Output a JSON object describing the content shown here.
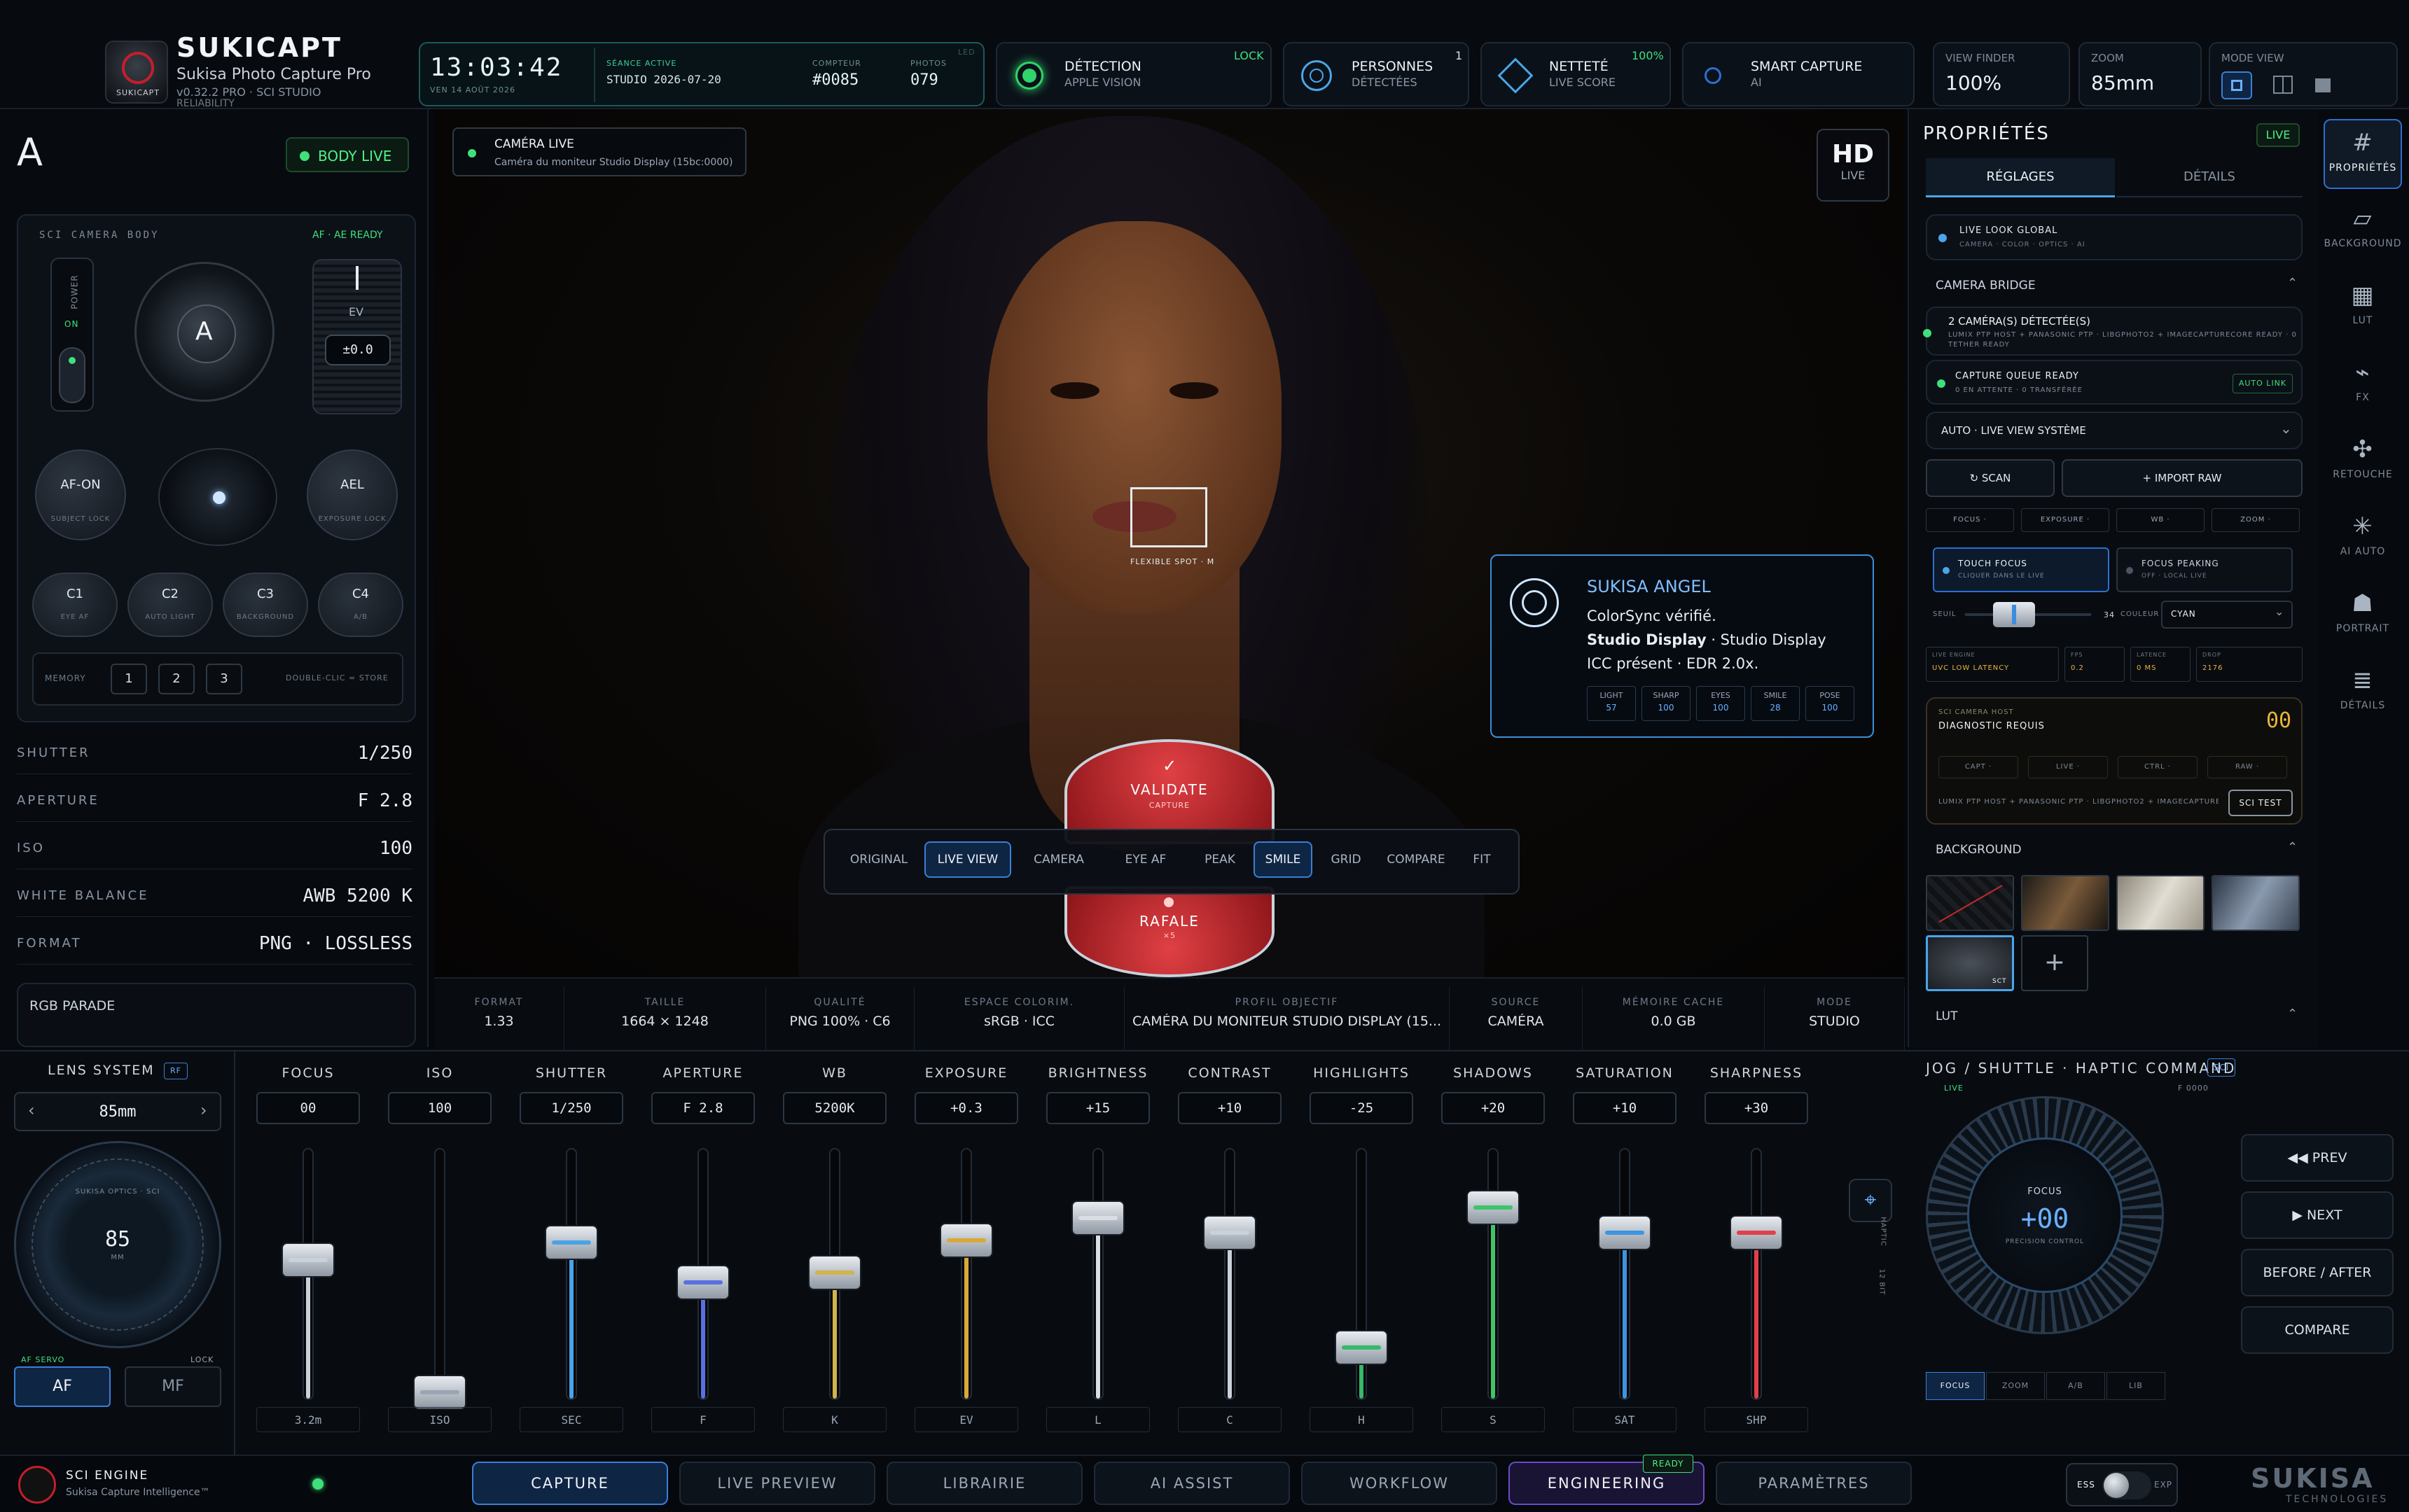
{
  "app": {
    "name": "SUKICAPT",
    "subtitle": "Sukisa Photo Capture Pro",
    "version": "v0.32.2 PRO · SCI STUDIO",
    "tag": "RELIABILITY",
    "logo_text": "SUKICAPT"
  },
  "clock": {
    "time": "13:03:42",
    "date": "VEN 14 AOÛT 2026",
    "session_label": "SÉANCE ACTIVE",
    "session": "STUDIO 2026-07-20",
    "counter_label": "COMPTEUR",
    "counter": "#0085",
    "photos_label": "PHOTOS",
    "photos": "079",
    "led": "LED"
  },
  "status": {
    "detection": {
      "title": "DÉTECTION",
      "sub": "APPLE VISION",
      "badge": "LOCK"
    },
    "persons": {
      "title": "PERSONNES",
      "sub": "DÉTECTÉES",
      "badge": "1"
    },
    "sharp": {
      "title": "NETTETÉ",
      "sub": "LIVE SCORE",
      "badge": "100%"
    },
    "smart": {
      "title": "SMART CAPTURE",
      "sub": "AI"
    },
    "viewfinder": {
      "label": "VIEW FINDER",
      "value": "100%"
    },
    "zoom": {
      "label": "ZOOM",
      "value": "85mm"
    },
    "mode": {
      "label": "MODE VIEW"
    }
  },
  "left": {
    "mode_letter": "A",
    "body_live": "BODY LIVE",
    "body_label": "SCI CAMERA BODY",
    "af_ready": "AF · AE READY",
    "power": "POWER",
    "on": "ON",
    "dial_letter": "A",
    "ev_label": "EV",
    "ev_value": "±0.0",
    "afon": "AF-ON",
    "afon_sub": "SUBJECT LOCK",
    "ael": "AEL",
    "ael_sub": "EXPOSURE LOCK",
    "customs": [
      {
        "t": "C1",
        "s": "EYE AF"
      },
      {
        "t": "C2",
        "s": "AUTO LIGHT"
      },
      {
        "t": "C3",
        "s": "BACKGROUND"
      },
      {
        "t": "C4",
        "s": "A/B"
      }
    ],
    "memory": "MEMORY",
    "mem": [
      "1",
      "2",
      "3"
    ],
    "mem_hint": "DOUBLE-CLIC = STORE",
    "props": [
      {
        "k": "SHUTTER",
        "v": "1/250"
      },
      {
        "k": "APERTURE",
        "v": "F 2.8"
      },
      {
        "k": "ISO",
        "v": "100"
      },
      {
        "k": "WHITE BALANCE",
        "v": "AWB  5200 K"
      },
      {
        "k": "FORMAT",
        "v": "PNG · LOSSLESS"
      }
    ],
    "rgb": "RGB PARADE"
  },
  "viewer": {
    "cam_title": "CAMÉRA LIVE",
    "cam_sub": "Caméra du moniteur Studio Display (15bc:0000)",
    "hd": "HD",
    "hd_sub": "LIVE",
    "spot": "FLEXIBLE SPOT · M",
    "angel_title": "SUKISA ANGEL",
    "angel_l1": "ColorSync vérifié.",
    "angel_l2b": "Studio Display",
    "angel_l2": " · Studio Display",
    "angel_l3": "ICC présent · EDR 2.0x.",
    "scores": [
      {
        "k": "LIGHT",
        "v": "57"
      },
      {
        "k": "SHARP",
        "v": "100"
      },
      {
        "k": "EYES",
        "v": "100"
      },
      {
        "k": "SMILE",
        "v": "28"
      },
      {
        "k": "POSE",
        "v": "100"
      }
    ],
    "validate": "VALIDATE",
    "validate_sub": "CAPTURE",
    "rafale": "RAFALE",
    "rafale_sub": "×5",
    "view_btns": [
      "ORIGINAL",
      "LIVE VIEW",
      "CAMERA",
      "EYE AF",
      "PEAK",
      "SMILE",
      "GRID",
      "COMPARE",
      "FIT"
    ],
    "info": [
      {
        "k": "FORMAT",
        "v": "1.33"
      },
      {
        "k": "TAILLE",
        "v": "1664 × 1248"
      },
      {
        "k": "QUALITÉ",
        "v": "PNG 100% · C6"
      },
      {
        "k": "ESPACE COLORIM.",
        "v": "sRGB · ICC"
      },
      {
        "k": "PROFIL OBJECTIF",
        "v": "CAMÉRA DU MONITEUR STUDIO DISPLAY (15..."
      },
      {
        "k": "SOURCE",
        "v": "CAMÉRA"
      },
      {
        "k": "MÉMOIRE CACHE",
        "v": "0.0 GB"
      },
      {
        "k": "MODE",
        "v": "STUDIO"
      }
    ]
  },
  "props": {
    "title": "PROPRIÉTÉS",
    "live": "LIVE",
    "tab1": "RÉGLAGES",
    "tab2": "DÉTAILS",
    "look": "LIVE LOOK GLOBAL",
    "look_sub": "CAMERA · COLOR · OPTICS · AI",
    "bridge": "CAMERA BRIDGE",
    "cams": "2 CAMÉRA(S) DÉTECTÉE(S)",
    "cams_sub": "LUMIX PTP HOST + PANASONIC PTP · LIBGPHOTO2 + IMAGECAPTURECORE READY · 0 TETHER READY",
    "queue": "CAPTURE QUEUE READY",
    "queue_sub": "0 EN ATTENTE · 0 TRANSFÉRÉE",
    "auto_link": "AUTO LINK",
    "select": "AUTO · LIVE VIEW SYSTÈME",
    "scan": "↻ SCAN",
    "import": "+ IMPORT RAW",
    "mini": [
      "FOCUS ·",
      "EXPOSURE ·",
      "WB ·",
      "ZOOM ·"
    ],
    "touch": "TOUCH FOCUS",
    "touch_sub": "CLIQUER DANS LE LIVE",
    "peaking": "FOCUS PEAKING",
    "peaking_sub": "OFF · LOCAL LIVE",
    "seuil": "SEUIL",
    "seuil_v": "34",
    "couleur": "COULEUR",
    "couleur_v": "CYAN",
    "engine": [
      {
        "k": "LIVE ENGINE",
        "v": "UVC LOW LATENCY"
      },
      {
        "k": "FPS",
        "v": "0.2"
      },
      {
        "k": "LATENCE",
        "v": "0 MS"
      },
      {
        "k": "DROP",
        "v": "2176"
      }
    ],
    "host": "SCI CAMERA HOST",
    "diag": "DIAGNOSTIC REQUIS",
    "diag_n": "00",
    "host_btns": [
      "CAPT ·",
      "LIVE ·",
      "CTRL ·",
      "RAW ·"
    ],
    "host_line": "LUMIX PTP HOST + PANASONIC PTP · LIBGPHOTO2 + IMAGECAPTURECO...",
    "sci_test": "SCI TEST",
    "background": "BACKGROUND",
    "sct": "SCT",
    "lut": "LUT"
  },
  "side": [
    {
      "icon": "#",
      "label": "PROPRIÉTÉS"
    },
    {
      "icon": "▱",
      "label": "BACKGROUND"
    },
    {
      "icon": "▦",
      "label": "LUT"
    },
    {
      "icon": "⌁",
      "label": "FX"
    },
    {
      "icon": "✣",
      "label": "RETOUCHE"
    },
    {
      "icon": "✳",
      "label": "AI AUTO"
    },
    {
      "icon": "☗",
      "label": "PORTRAIT"
    },
    {
      "icon": "≣",
      "label": "DÉTAILS"
    }
  ],
  "lens": {
    "title": "LENS SYSTEM",
    "rf": "RF",
    "focal": "85mm",
    "ring": "SUKISA OPTICS · SCI",
    "big": "85",
    "big_sub": "MM",
    "af_servo": "AF SERVO",
    "lock": "LOCK",
    "af": "AF",
    "mf": "MF",
    "prev": "‹",
    "next": "›"
  },
  "sliders": [
    {
      "name": "FOCUS",
      "val": "00",
      "unit": "3.2m",
      "pos": 0.55,
      "color": "#c9d1da"
    },
    {
      "name": "ISO",
      "val": "100",
      "unit": "ISO",
      "pos": 0.02,
      "color": "#9aa6b5"
    },
    {
      "name": "SHUTTER",
      "val": "1/250",
      "unit": "SEC",
      "pos": 0.62,
      "color": "#4aa3e8"
    },
    {
      "name": "APERTURE",
      "val": "F 2.8",
      "unit": "F",
      "pos": 0.46,
      "color": "#5a6fe0"
    },
    {
      "name": "WB",
      "val": "5200K",
      "unit": "K",
      "pos": 0.5,
      "color": "#d3b34a"
    },
    {
      "name": "EXPOSURE",
      "val": "+0.3",
      "unit": "EV",
      "pos": 0.63,
      "color": "#d8a93a"
    },
    {
      "name": "BRIGHTNESS",
      "val": "+15",
      "unit": "L",
      "pos": 0.72,
      "color": "#d9dee5"
    },
    {
      "name": "CONTRAST",
      "val": "+10",
      "unit": "C",
      "pos": 0.66,
      "color": "#c9d1da"
    },
    {
      "name": "HIGHLIGHTS",
      "val": "-25",
      "unit": "H",
      "pos": 0.2,
      "color": "#37b86a"
    },
    {
      "name": "SHADOWS",
      "val": "+20",
      "unit": "S",
      "pos": 0.76,
      "color": "#3fc46a"
    },
    {
      "name": "SATURATION",
      "val": "+10",
      "unit": "SAT",
      "pos": 0.66,
      "color": "#3d95e0"
    },
    {
      "name": "SHARPNESS",
      "val": "+30",
      "unit": "SHP",
      "pos": 0.66,
      "color": "#e0404a"
    }
  ],
  "jog": {
    "title": "JOG / SHUTTLE · HAPTIC COMMAND",
    "sci": "SCI",
    "live": "LIVE",
    "f": "F 0000",
    "focus": "FOCUS",
    "value": "+00",
    "sub": "PRECISION CONTROL",
    "haptic": "HAPTIC",
    "bit": "12 BIT",
    "modes": [
      "FOCUS",
      "ZOOM",
      "A/B",
      "LIB"
    ],
    "prev": "◀◀ PREV",
    "next": "▶ NEXT",
    "ba": "BEFORE / AFTER",
    "compare": "COMPARE"
  },
  "footer": {
    "engine": "SCI ENGINE",
    "engine_sub": "Sukisa Capture Intelligence™",
    "tabs": [
      "CAPTURE",
      "LIVE PREVIEW",
      "LIBRAIRIE",
      "AI ASSIST",
      "WORKFLOW",
      "ENGINEERING",
      "PARAMÈTRES"
    ],
    "ready": "READY",
    "ess": "ESS",
    "exp": "EXP",
    "brand": "SUKISA",
    "brand_sub": "TECHNOLOGIES"
  }
}
